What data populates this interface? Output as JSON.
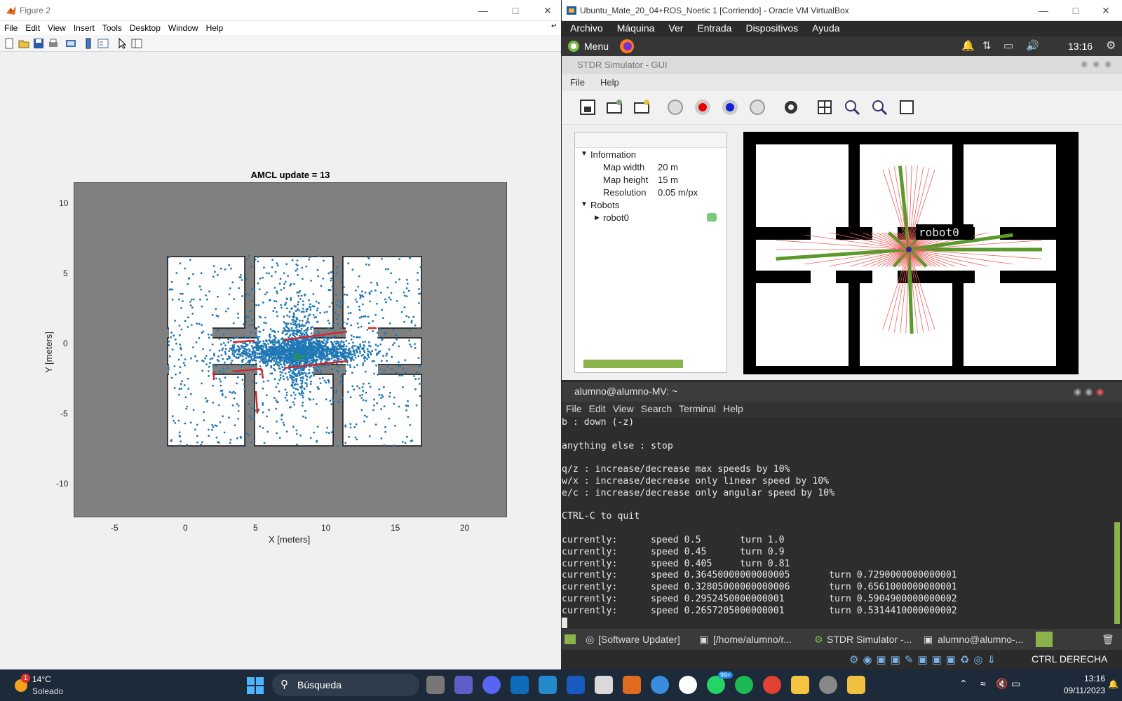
{
  "figure": {
    "window_title": "Figure 2",
    "menu": [
      "File",
      "Edit",
      "View",
      "Insert",
      "Tools",
      "Desktop",
      "Window",
      "Help"
    ],
    "plot_title": "AMCL update = 13",
    "xlabel": "X [meters]",
    "ylabel": "Y [meters]",
    "xticks": [
      "-5",
      "0",
      "5",
      "10",
      "15",
      "20"
    ],
    "yticks": [
      "10",
      "5",
      "0",
      "-5",
      "-10"
    ]
  },
  "chart_data": {
    "type": "scatter",
    "title": "AMCL update = 13",
    "xlabel": "X [meters]",
    "ylabel": "Y [meters]",
    "xlim": [
      -8,
      23
    ],
    "ylim": [
      -12.5,
      11.5
    ],
    "xticks": [
      -5,
      0,
      5,
      10,
      15,
      20
    ],
    "yticks": [
      -10,
      -5,
      0,
      5,
      10
    ],
    "grid": false,
    "colors": {
      "particles": "#1f77b4",
      "scan": "#d62728",
      "background": "#808080",
      "free": "#ffffff"
    }
  },
  "virtualbox": {
    "window_title": "Ubuntu_Mate_20_04+ROS_Noetic 1 [Corriendo] - Oracle VM VirtualBox",
    "menu": [
      "Archivo",
      "Máquina",
      "Ver",
      "Entrada",
      "Dispositivos",
      "Ayuda"
    ],
    "mate_menu": "Menu",
    "clock": "13:16",
    "status_key": "CTRL DERECHA"
  },
  "stdr": {
    "window_title": "STDR Simulator - GUI",
    "menu": [
      "File",
      "Help"
    ],
    "tree": {
      "information": "Information",
      "map_width_label": "Map width",
      "map_width": "20 m",
      "map_height_label": "Map height",
      "map_height": "15 m",
      "resolution_label": "Resolution",
      "resolution": "0.05 m/px",
      "robots": "Robots",
      "robot": "robot0"
    },
    "robot_label": "robot0"
  },
  "terminal": {
    "title": "alumno@alumno-MV: ~",
    "menu": [
      "File",
      "Edit",
      "View",
      "Search",
      "Terminal",
      "Help"
    ],
    "lines": [
      "b : down (-z)",
      "",
      "anything else : stop",
      "",
      "q/z : increase/decrease max speeds by 10%",
      "w/x : increase/decrease only linear speed by 10%",
      "e/c : increase/decrease only angular speed by 10%",
      "",
      "CTRL-C to quit",
      "",
      "currently:\tspeed 0.5\tturn 1.0",
      "currently:\tspeed 0.45\tturn 0.9",
      "currently:\tspeed 0.405\tturn 0.81",
      "currently:\tspeed 0.36450000000000005\tturn 0.7290000000000001",
      "currently:\tspeed 0.32805000000000006\tturn 0.6561000000000001",
      "currently:\tspeed 0.2952450000000001\tturn 0.5904900000000002",
      "currently:\tspeed 0.2657205000000001\tturn 0.5314410000000002"
    ]
  },
  "mate_taskbar": {
    "items": [
      "[Software Updater]",
      "[/home/alumno/r...",
      "STDR Simulator -...",
      "alumno@alumno-..."
    ]
  },
  "taskbar": {
    "weather_temp": "14°C",
    "weather_desc": "Soleado",
    "weather_badge": "1",
    "search_placeholder": "Búsqueda",
    "whatsapp_badge": "99+",
    "time": "13:16",
    "date": "09/11/2023"
  }
}
